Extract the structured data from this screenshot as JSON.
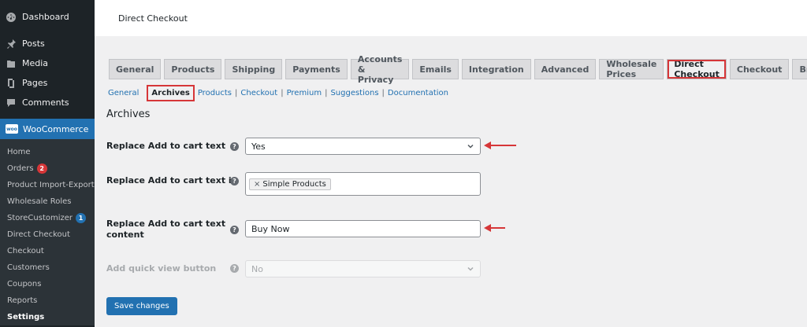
{
  "sidebar": {
    "items": [
      {
        "label": "Dashboard",
        "icon": "dashboard-icon"
      },
      {
        "label": "Posts",
        "icon": "pin-icon"
      },
      {
        "label": "Media",
        "icon": "media-icon"
      },
      {
        "label": "Pages",
        "icon": "pages-icon"
      },
      {
        "label": "Comments",
        "icon": "comments-icon"
      }
    ],
    "woocommerce": {
      "label": "WooCommerce",
      "icon_text": "woo"
    },
    "submenu": [
      {
        "label": "Home"
      },
      {
        "label": "Orders",
        "badge": "2"
      },
      {
        "label": "Product Import-Export"
      },
      {
        "label": "Wholesale Roles"
      },
      {
        "label": "StoreCustomizer",
        "badge": "1"
      },
      {
        "label": "Direct Checkout"
      },
      {
        "label": "Checkout"
      },
      {
        "label": "Customers"
      },
      {
        "label": "Coupons"
      },
      {
        "label": "Reports"
      },
      {
        "label": "Settings"
      }
    ]
  },
  "header": {
    "title": "Direct Checkout"
  },
  "tabs": [
    "General",
    "Products",
    "Shipping",
    "Payments",
    "Accounts & Privacy",
    "Emails",
    "Integration",
    "Advanced",
    "Wholesale Prices",
    "Direct Checkout",
    "Checkout",
    "Brands"
  ],
  "active_tab": "Direct Checkout",
  "subnav": [
    "General",
    "Archives",
    "Products",
    "Checkout",
    "Premium",
    "Suggestions",
    "Documentation"
  ],
  "section_title": "Archives",
  "fields": {
    "replace_text": {
      "label": "Replace Add to cart text",
      "value": "Yes"
    },
    "replace_text_in": {
      "label": "Replace Add to cart text in",
      "chip": "Simple Products",
      "chip_remove": "×"
    },
    "replace_content": {
      "label_line1": "Replace Add to cart text",
      "label_line2": "content",
      "value": "Buy Now"
    },
    "quick_view": {
      "label": "Add quick view button",
      "value": "No"
    }
  },
  "help_glyph": "?",
  "save_label": "Save changes",
  "colors": {
    "accent": "#2271b1",
    "highlight": "#d63638",
    "sidebar": "#1d2327"
  }
}
